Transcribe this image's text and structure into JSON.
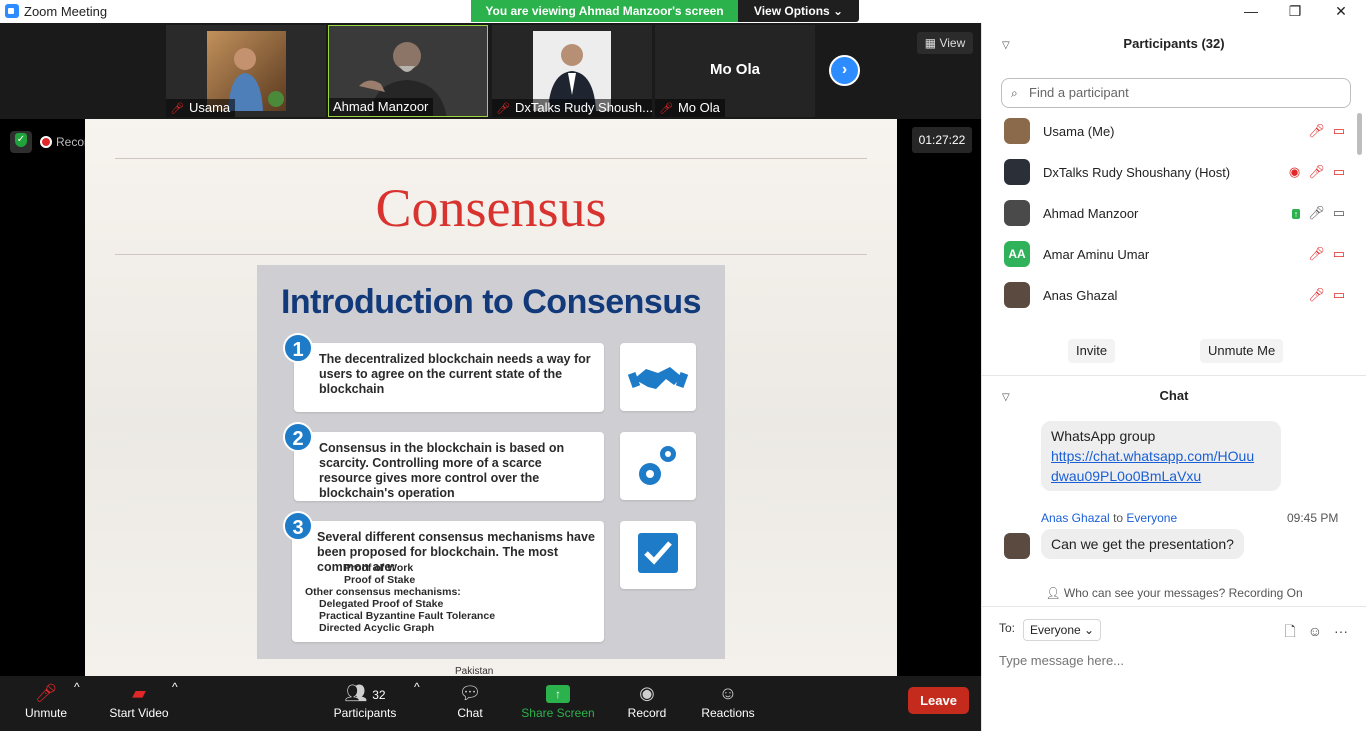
{
  "window": {
    "title": "Zoom Meeting",
    "min": "—",
    "restore": "❐",
    "close": "✕"
  },
  "share_banner": {
    "text": "You are viewing Ahmad Manzoor's screen",
    "options": "View Options ⌄"
  },
  "gallery": {
    "view_label": "View",
    "tiles": [
      {
        "name": "Usama",
        "muted": true
      },
      {
        "name": "Ahmad Manzoor",
        "muted": false
      },
      {
        "name": "DxTalks Rudy Shoush...",
        "muted": true
      },
      {
        "name": "Mo Ola",
        "muted": true,
        "display": "Mo Ola"
      }
    ]
  },
  "recording": {
    "label": "Recording",
    "timer": "01:27:22"
  },
  "slide": {
    "heading": "Consensus",
    "card_title": "Introduction to Consensus",
    "points": [
      {
        "num": "1",
        "text": "The decentralized blockchain needs a way for users to agree on the current state of the blockchain"
      },
      {
        "num": "2",
        "text": "Consensus in the blockchain is based on scarcity. Controlling more of a scarce resource gives more control over the blockchain's operation"
      },
      {
        "num": "3",
        "text": "Several different consensus mechanisms have been proposed for blockchain. The most common are:",
        "sub": [
          "Proof of Work",
          "Proof of Stake"
        ],
        "other_label": "Other consensus mechanisms:",
        "other": [
          "Delegated Proof of Stake",
          "Practical Byzantine Fault Tolerance",
          "Directed Acyclic Graph"
        ]
      }
    ],
    "footer": "Pakistan"
  },
  "toolbar": {
    "unmute": "Unmute",
    "start_video": "Start Video",
    "participants": "Participants",
    "participant_count": "32",
    "chat": "Chat",
    "share_screen": "Share Screen",
    "record": "Record",
    "reactions": "Reactions",
    "leave": "Leave"
  },
  "participants_panel": {
    "title": "Participants (32)",
    "search_placeholder": "Find a participant",
    "people": [
      {
        "name": "Usama  (Me)",
        "icons": [
          "mic-muted",
          "video-off"
        ]
      },
      {
        "name": "DxTalks Rudy Shoushany (Host)",
        "icons": [
          "record",
          "mic-muted",
          "video-off"
        ]
      },
      {
        "name": "Ahmad Manzoor",
        "icons": [
          "share",
          "mic",
          "video"
        ]
      },
      {
        "name": "Amar Aminu Umar",
        "initials": "AA",
        "icons": [
          "mic-muted",
          "video-off"
        ]
      },
      {
        "name": "Anas Ghazal",
        "icons": [
          "mic-muted",
          "video-off"
        ]
      }
    ],
    "invite": "Invite",
    "unmute_me": "Unmute Me"
  },
  "chat_panel": {
    "title": "Chat",
    "msg1_text": "WhatsApp group",
    "msg1_link_a": "https://chat.whatsapp.com/HOuu",
    "msg1_link_b": "dwau09PL0o0BmLaVxu",
    "msg2_sender": "Anas Ghazal",
    "msg2_to_word": "to",
    "msg2_to": "Everyone",
    "msg2_time": "09:45 PM",
    "msg2_text": "Can we get the presentation?",
    "who_can_see": "Who can see your messages? Recording On",
    "to_label": "To:",
    "to_value": "Everyone ⌄",
    "input_placeholder": "Type message here..."
  },
  "colors": {
    "accent": "#2d8cff",
    "share_green": "#2bb24c",
    "leave_red": "#c42b1c",
    "slide_title_red": "#d9332f",
    "card_title_blue": "#123a7a"
  }
}
